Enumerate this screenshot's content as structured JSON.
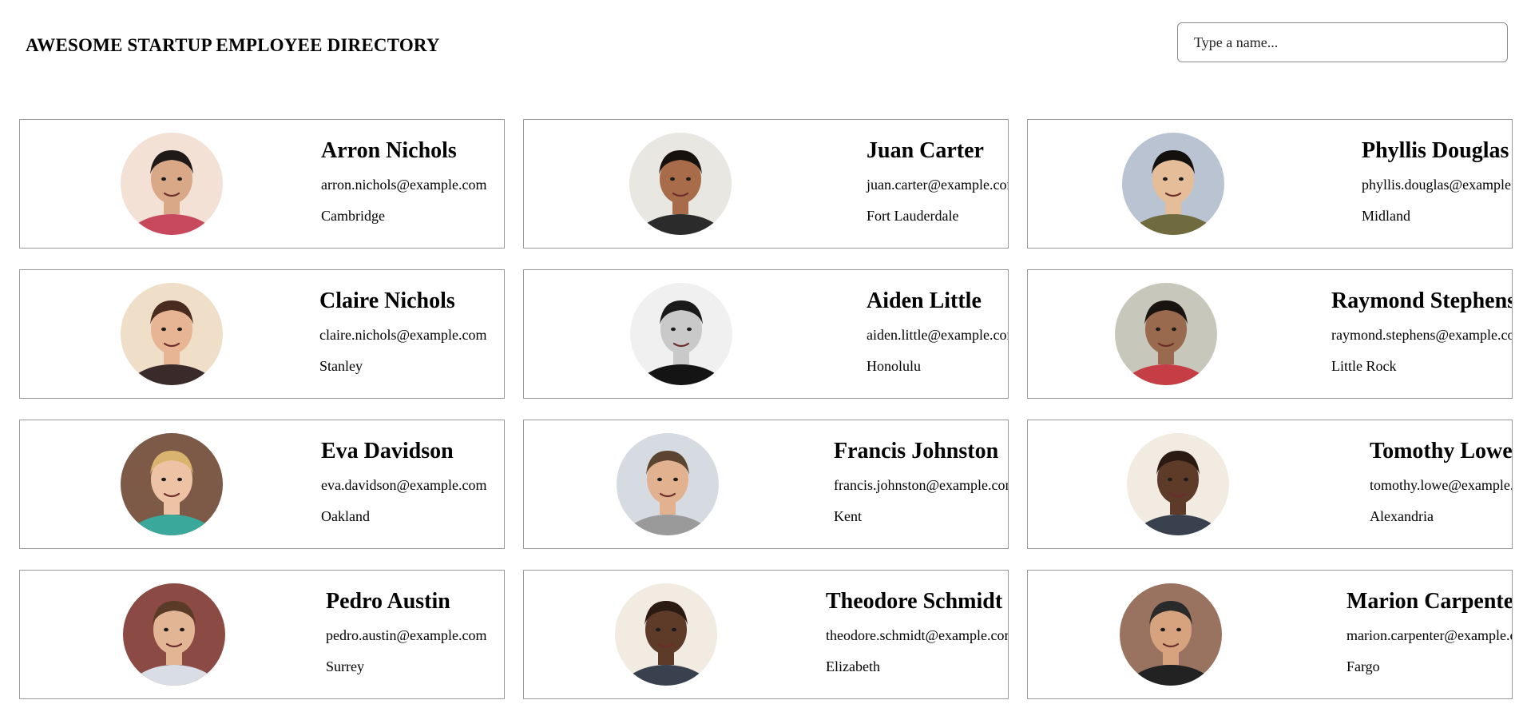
{
  "header": {
    "title": "AWESOME STARTUP EMPLOYEE DIRECTORY"
  },
  "search": {
    "placeholder": "Type a name..."
  },
  "employees": [
    {
      "name": "Arron Nichols",
      "email": "arron.nichols@example.com",
      "city": "Cambridge",
      "skin": "#d9a887",
      "hair": "#1f1a17",
      "shirt": "#c8485e",
      "bg": "#f3e1d6"
    },
    {
      "name": "Juan Carter",
      "email": "juan.carter@example.com",
      "city": "Fort Lauderdale",
      "skin": "#a86c4b",
      "hair": "#17110e",
      "shirt": "#2b2b2b",
      "bg": "#e9e7e2"
    },
    {
      "name": "Phyllis Douglas",
      "email": "phyllis.douglas@example.com",
      "city": "Midland",
      "skin": "#e6bd99",
      "hair": "#14100d",
      "shirt": "#6f6b3e",
      "bg": "#b9c3d2"
    },
    {
      "name": "Claire Nichols",
      "email": "claire.nichols@example.com",
      "city": "Stanley",
      "skin": "#e7b494",
      "hair": "#4a2b20",
      "shirt": "#3a2a2a",
      "bg": "#f0dfc8"
    },
    {
      "name": "Aiden Little",
      "email": "aiden.little@example.com",
      "city": "Honolulu",
      "skin": "#c9c9c9",
      "hair": "#1a1a1a",
      "shirt": "#141414",
      "bg": "#f0f0f0"
    },
    {
      "name": "Raymond Stephens",
      "email": "raymond.stephens@example.com",
      "city": "Little Rock",
      "skin": "#9a6a4e",
      "hair": "#1a1410",
      "shirt": "#c53d45",
      "bg": "#c7c8bb"
    },
    {
      "name": "Eva Davidson",
      "email": "eva.davidson@example.com",
      "city": "Oakland",
      "skin": "#eec2a4",
      "hair": "#d9b46e",
      "shirt": "#3aa89a",
      "bg": "#7d5a48"
    },
    {
      "name": "Francis Johnston",
      "email": "francis.johnston@example.com",
      "city": "Kent",
      "skin": "#e1b190",
      "hair": "#5c4530",
      "shirt": "#9a9a9a",
      "bg": "#d6dbe2"
    },
    {
      "name": "Tomothy Lowe",
      "email": "tomothy.lowe@example.com",
      "city": "Alexandria",
      "skin": "#5e3a28",
      "hair": "#2a1a12",
      "shirt": "#39414f",
      "bg": "#f1ebe2"
    },
    {
      "name": "Pedro Austin",
      "email": "pedro.austin@example.com",
      "city": "Surrey",
      "skin": "#e2b595",
      "hair": "#5a3b28",
      "shirt": "#d9dde6",
      "bg": "#8b4a44"
    },
    {
      "name": "Theodore Schmidt",
      "email": "theodore.schmidt@example.com",
      "city": "Elizabeth",
      "skin": "#5e3a28",
      "hair": "#2a1a12",
      "shirt": "#39414f",
      "bg": "#f1ebe2"
    },
    {
      "name": "Marion Carpenter",
      "email": "marion.carpenter@example.com",
      "city": "Fargo",
      "skin": "#d7a37e",
      "hair": "#2a2a2a",
      "shirt": "#222222",
      "bg": "#9a7260"
    }
  ]
}
